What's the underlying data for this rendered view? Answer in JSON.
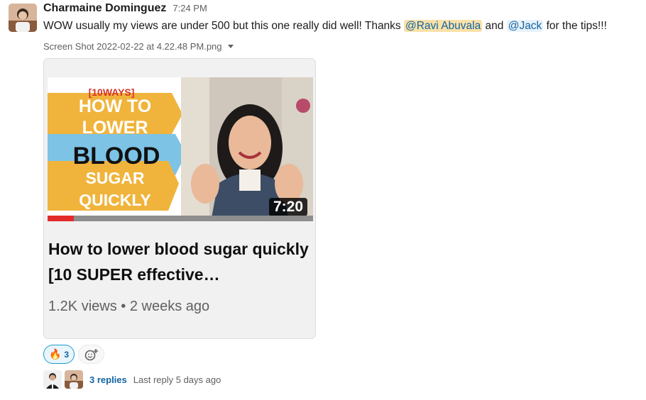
{
  "message": {
    "author": "Charmaine Dominguez",
    "time": "7:24 PM",
    "text_before": "WOW usually my views are under 500 but this one really did well! Thanks ",
    "mention_1": "@Ravi Abuvala",
    "text_between": " and ",
    "mention_2": "@Jack",
    "text_after": " for the tips!!!"
  },
  "attachment": {
    "filename": "Screen Shot 2022-02-22 at 4.22.48 PM.png",
    "thumbnail": {
      "tag": "[10WAYS]",
      "line1": "HOW TO",
      "line2": "LOWER",
      "line3": "BLOOD",
      "line4": "SUGAR",
      "line5": "QUICKLY",
      "duration": "7:20",
      "watched_fraction": 0.1
    },
    "video_title": "How to lower blood sugar quickly [10 SUPER effective…",
    "video_meta": "1.2K views • 2 weeks ago"
  },
  "reactions": [
    {
      "emoji": "🔥",
      "count": "3"
    }
  ],
  "thread": {
    "replies": "3 replies",
    "last_reply": "Last reply 5 days ago"
  },
  "colors": {
    "link": "#1264a3",
    "mention_highlight": "#f9e1a8",
    "progress": "#e32b2b"
  }
}
